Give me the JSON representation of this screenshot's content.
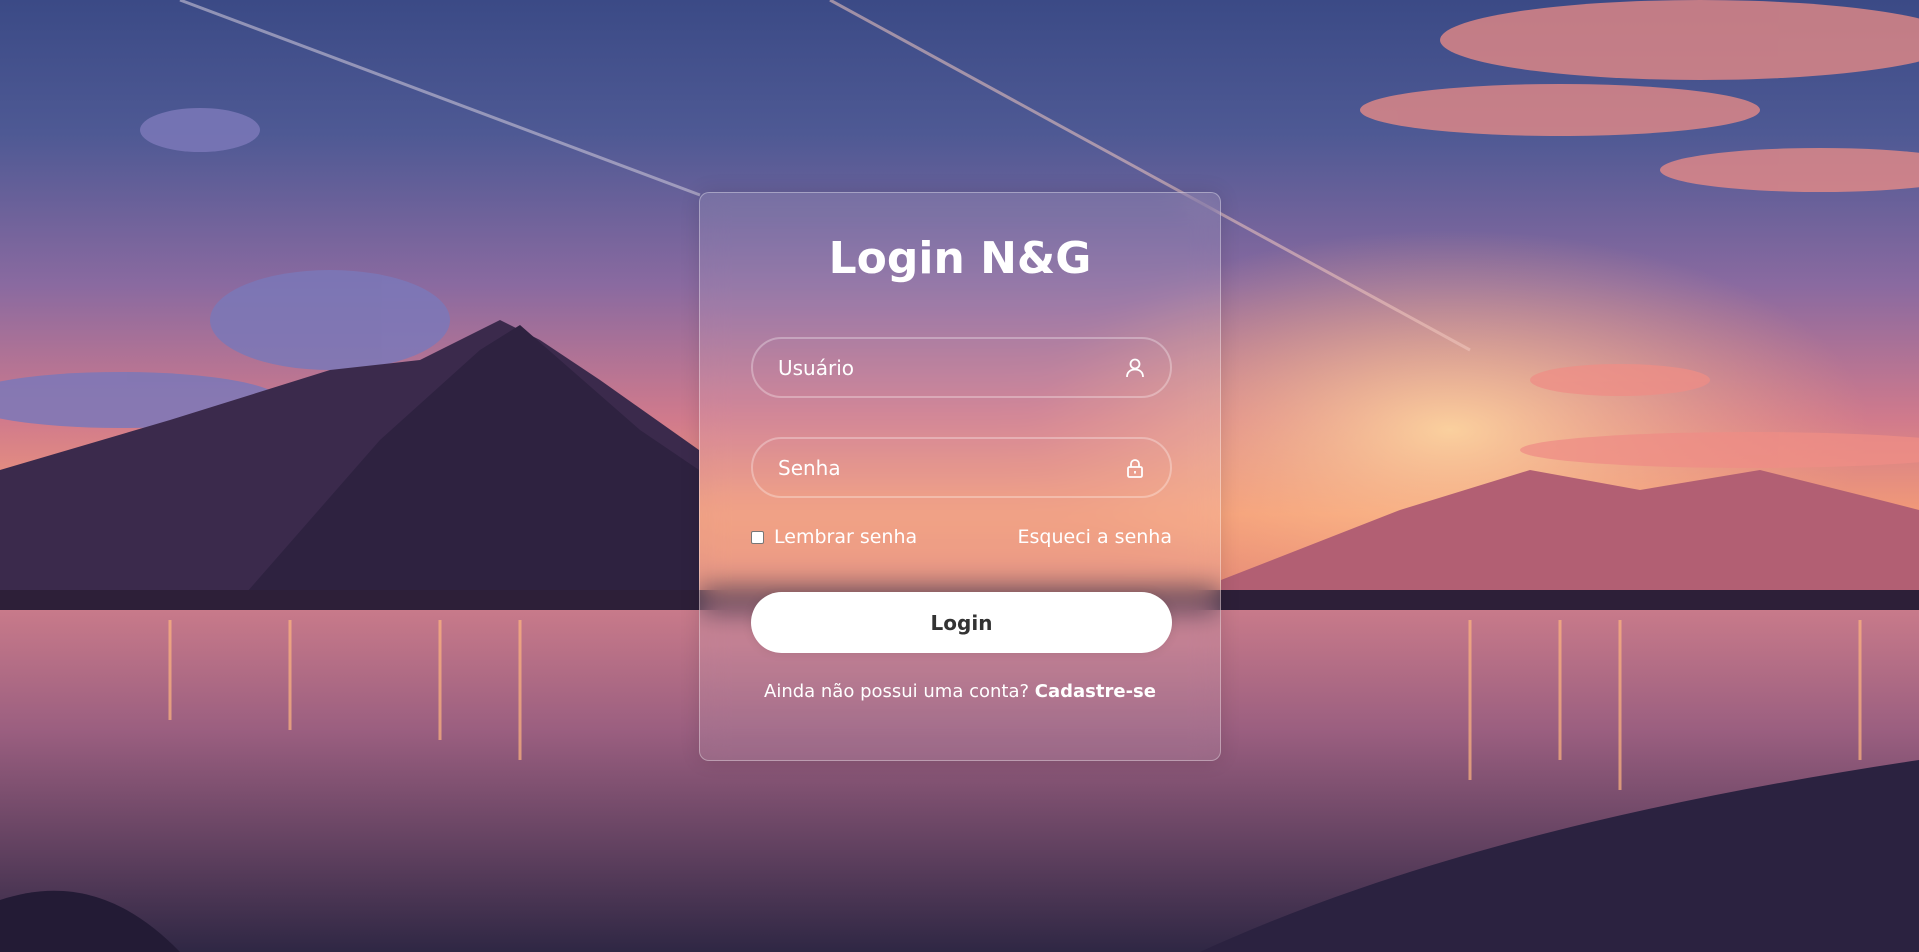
{
  "login": {
    "title": "Login N&G",
    "username_placeholder": "Usuário",
    "username_icon": "user-icon",
    "password_placeholder": "Senha",
    "password_icon": "lock-icon",
    "remember_label": "Lembrar senha",
    "remember_checked": false,
    "forgot_link": "Esqueci a senha",
    "submit_label": "Login",
    "register_prompt": "Ainda não possui uma conta?",
    "register_link": "Cadastre-se"
  },
  "colors": {
    "text": "#ffffff",
    "button_bg": "#ffffff",
    "button_text": "#333333"
  }
}
